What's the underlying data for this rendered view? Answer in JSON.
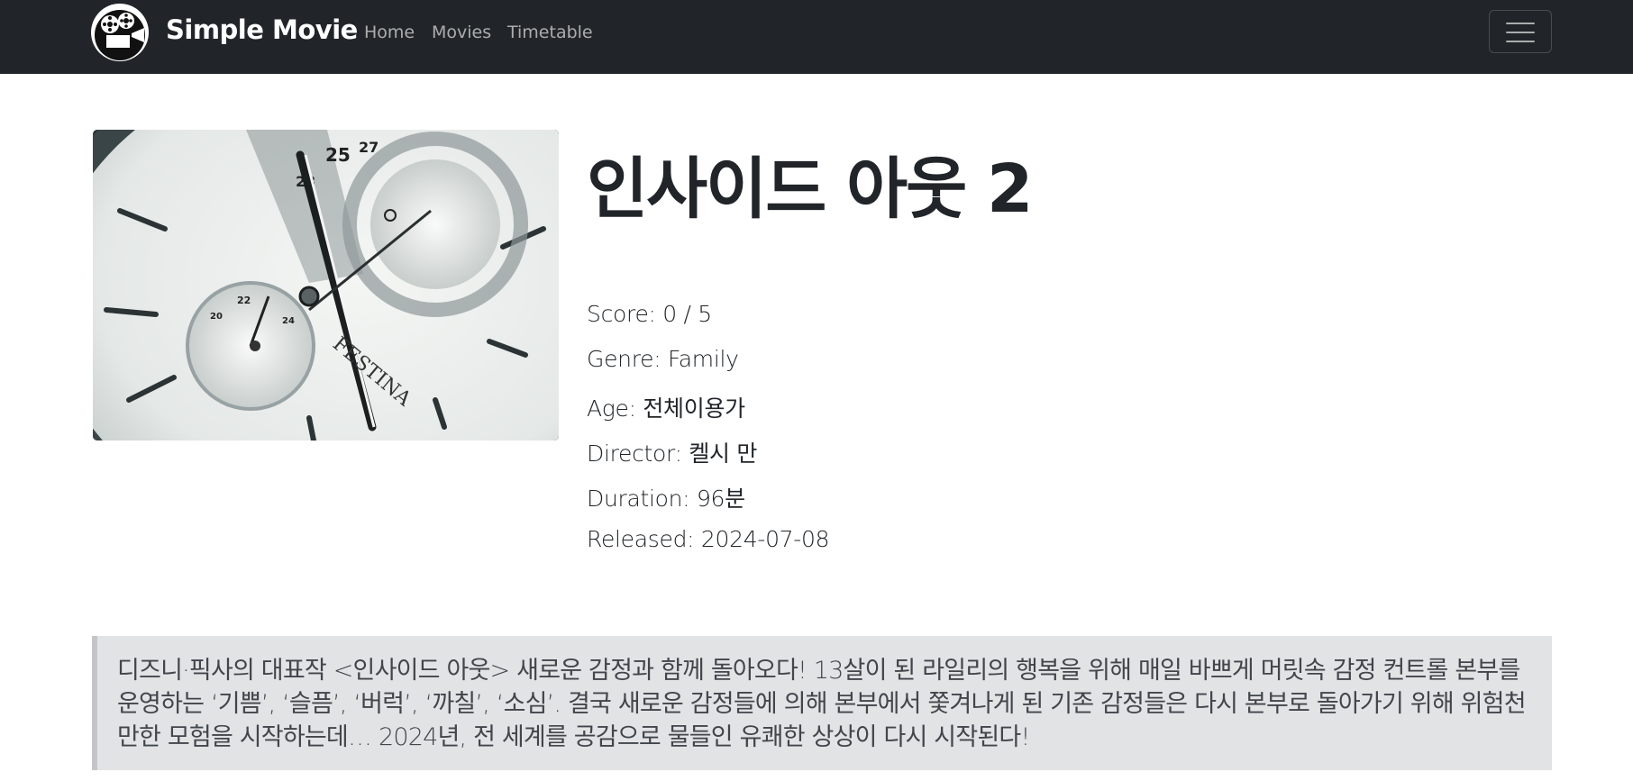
{
  "navbar": {
    "brand": "Simple Movie",
    "links": [
      "Home",
      "Movies",
      "Timetable"
    ],
    "menu_icon": "hamburger-menu-icon",
    "logo_icon": "movie-reel-logo-icon",
    "background": "#212529"
  },
  "movie": {
    "title": "인사이드 아웃 2",
    "poster_icon": "watch-face-poster-image",
    "info": {
      "score": "Score: 0 / 5",
      "genre": "Genre: Family",
      "age": "Age: 전체이용가",
      "director": "Director: 켈시 만",
      "duration": "Duration: 96분",
      "released": "Released: 2024-07-08"
    },
    "synopsis": "디즈니·픽사의 대표작 <인사이드 아웃> 새로운 감정과 함께 돌아오다! 13살이 된 라일리의 행복을 위해 매일 바쁘게 머릿속 감정 컨트롤 본부를 운영하는 ‘기쁨’, ‘슬픔’, ‘버럭’, ‘까칠’, ‘소심’. 결국 새로운 감정들에 의해 본부에서 쫓겨나게 된 기존 감정들은 다시 본부로 돌아가기 위해 위험천만한 모험을 시작하는데… 2024년, 전 세계를 공감으로 물들인 유쾌한 상상이 다시 시작된다!"
  }
}
